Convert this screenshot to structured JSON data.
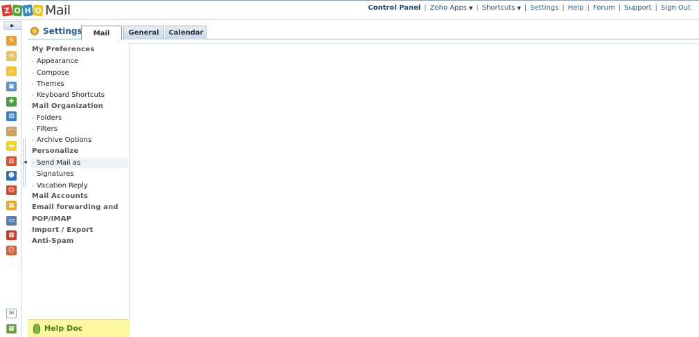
{
  "app": {
    "logo_letters": [
      "Z",
      "O",
      "H",
      "O"
    ],
    "brand": "Mail"
  },
  "topnav": {
    "links": [
      {
        "label": "Control Panel",
        "strong": true,
        "dropdown": false
      },
      {
        "label": "Zoho Apps",
        "dropdown": true
      },
      {
        "label": "Shortcuts",
        "dropdown": true
      },
      {
        "label": "Settings",
        "dropdown": false
      },
      {
        "label": "Help",
        "dropdown": false
      },
      {
        "label": "Forum",
        "dropdown": false
      },
      {
        "label": "Support",
        "dropdown": false
      },
      {
        "label": "Sign Out",
        "dropdown": false
      }
    ],
    "separator": "|"
  },
  "rail": {
    "toggle_icon": "chevron-right-icon",
    "icons": [
      "edit-icon",
      "notes-icon",
      "folder-icon",
      "contacts-card-icon",
      "puzzle-icon",
      "book-icon",
      "attachment-icon",
      "sticky-note-icon",
      "chart-icon",
      "contacts-icon",
      "user-icon",
      "inbox-icon",
      "vcard-icon",
      "calendar-icon",
      "person-icon"
    ],
    "bottom_icons": [
      "compose-new-icon",
      "apps-icon"
    ]
  },
  "settings": {
    "title": "Settings",
    "tabs": [
      {
        "label": "Mail",
        "active": true
      },
      {
        "label": "General",
        "active": false
      },
      {
        "label": "Calendar",
        "active": false
      }
    ]
  },
  "nav": {
    "entries": [
      {
        "type": "section",
        "label": "My Preferences"
      },
      {
        "type": "item",
        "label": "Appearance"
      },
      {
        "type": "item",
        "label": "Compose"
      },
      {
        "type": "item",
        "label": "Themes"
      },
      {
        "type": "item",
        "label": "Keyboard Shortcuts"
      },
      {
        "type": "section",
        "label": "Mail Organization"
      },
      {
        "type": "item",
        "label": "Folders"
      },
      {
        "type": "item",
        "label": "Filters"
      },
      {
        "type": "item",
        "label": "Archive Options"
      },
      {
        "type": "section",
        "label": "Personalize"
      },
      {
        "type": "item",
        "label": "Send Mail as",
        "selected": true
      },
      {
        "type": "item",
        "label": "Signatures"
      },
      {
        "type": "item",
        "label": "Vacation Reply"
      },
      {
        "type": "section",
        "label": "Mail Accounts"
      },
      {
        "type": "section",
        "label": "Email forwarding and"
      },
      {
        "type": "section",
        "label": "POP/IMAP"
      },
      {
        "type": "section",
        "label": "Import / Export"
      },
      {
        "type": "section",
        "label": "Anti-Spam"
      }
    ]
  },
  "help": {
    "label": "Help Doc"
  },
  "colors": {
    "accent": "#2a5d9a",
    "help_bg": "#fbf7a0",
    "help_text": "#4a7b1c"
  }
}
